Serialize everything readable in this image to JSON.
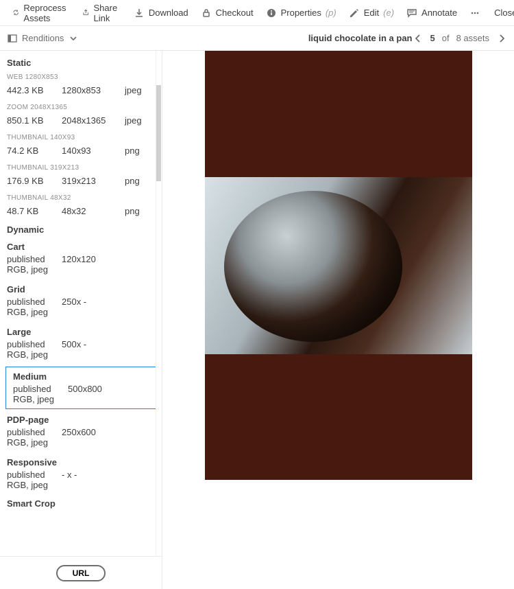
{
  "toolbar": {
    "reprocess": "Reprocess Assets",
    "share": "Share Link",
    "download": "Download",
    "checkout": "Checkout",
    "properties": "Properties",
    "properties_sh": "(p)",
    "edit": "Edit",
    "edit_sh": "(e)",
    "annotate": "Annotate",
    "close": "Close"
  },
  "subbar": {
    "renditions": "Renditions",
    "title": "liquid chocolate in a pan",
    "page_cur": "5",
    "page_mid": "of",
    "page_total": "8 assets"
  },
  "sections": {
    "static": "Static",
    "dynamic": "Dynamic",
    "smartcrop": "Smart Crop"
  },
  "static": [
    {
      "label": "WEB 1280X853",
      "size": "442.3 KB",
      "dim": "1280x853",
      "fmt": "jpeg"
    },
    {
      "label": "ZOOM 2048X1365",
      "size": "850.1 KB",
      "dim": "2048x1365",
      "fmt": "jpeg"
    },
    {
      "label": "THUMBNAIL 140X93",
      "size": "74.2 KB",
      "dim": "140x93",
      "fmt": "png"
    },
    {
      "label": "THUMBNAIL 319X213",
      "size": "176.9 KB",
      "dim": "319x213",
      "fmt": "png"
    },
    {
      "label": "THUMBNAIL 48X32",
      "size": "48.7 KB",
      "dim": "48x32",
      "fmt": "png"
    }
  ],
  "dynamic": [
    {
      "title": "Cart",
      "status": "published",
      "dim": "120x120",
      "meta": "RGB, jpeg"
    },
    {
      "title": "Grid",
      "status": "published",
      "dim": "250x -",
      "meta": "RGB, jpeg"
    },
    {
      "title": "Large",
      "status": "published",
      "dim": "500x -",
      "meta": "RGB, jpeg"
    },
    {
      "title": "Medium",
      "status": "published",
      "dim": "500x800",
      "meta": "RGB, jpeg"
    },
    {
      "title": "PDP-page",
      "status": "published",
      "dim": "250x600",
      "meta": "RGB, jpeg"
    },
    {
      "title": "Responsive",
      "status": "published",
      "dim": "- x -",
      "meta": "RGB, jpeg"
    }
  ],
  "footer": {
    "url": "URL"
  }
}
